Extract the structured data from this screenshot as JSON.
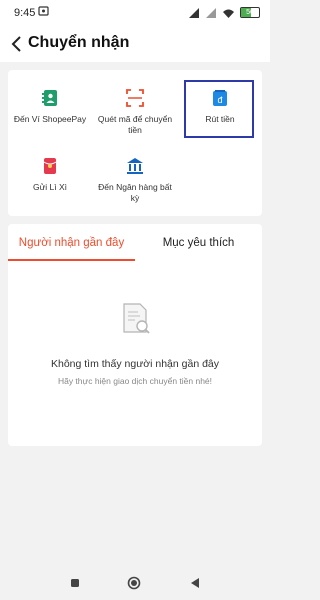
{
  "status_bar": {
    "time": "9:45",
    "battery_level": "56"
  },
  "header": {
    "title": "Chuyển nhận"
  },
  "services": [
    {
      "label": "Đến Ví ShopeePay",
      "icon": "wallet-book-icon",
      "color": "#1f9d6a"
    },
    {
      "label": "Quét mã để chuyển tiền",
      "icon": "qr-scan-icon",
      "color": "#ee4d2d"
    },
    {
      "label": "Rút tiền",
      "icon": "withdraw-icon",
      "color": "#1e88e5"
    },
    {
      "label": "Gửi Lì Xì",
      "icon": "red-envelope-icon",
      "color": "#e53950"
    },
    {
      "label": "Đến Ngân hàng bất kỳ",
      "icon": "bank-icon",
      "color": "#1565c0"
    }
  ],
  "tabs": [
    {
      "label": "Người nhận gần đây",
      "active": true
    },
    {
      "label": "Mục yêu thích",
      "active": false
    }
  ],
  "empty_state": {
    "title": "Không tìm thấy người nhận gần đây",
    "subtitle": "Hãy thực hiện giao dịch chuyển tiền nhé!"
  },
  "colors": {
    "accent": "#ee4d2d",
    "highlight_box": "#2e3aa8"
  }
}
